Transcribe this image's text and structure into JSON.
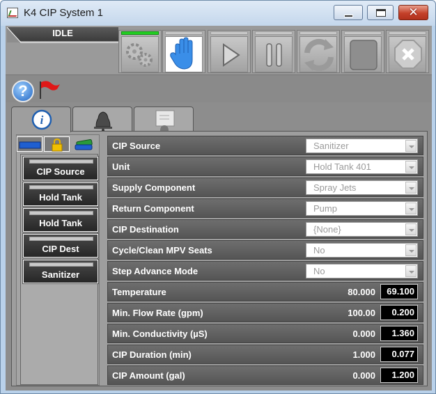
{
  "window": {
    "title": "K4 CIP System 1"
  },
  "toolbar": {
    "status": "IDLE",
    "buttons": [
      {
        "name": "auto",
        "icon": "gears-icon"
      },
      {
        "name": "manual",
        "icon": "hand-icon"
      },
      {
        "name": "start",
        "icon": "play-icon"
      },
      {
        "name": "pause",
        "icon": "pause-icon"
      },
      {
        "name": "restart",
        "icon": "refresh-icon"
      },
      {
        "name": "stop",
        "icon": "stop-icon"
      },
      {
        "name": "abort",
        "icon": "abort-icon"
      }
    ]
  },
  "tabs": [
    {
      "name": "info",
      "icon": "info-icon"
    },
    {
      "name": "alarms",
      "icon": "bell-icon"
    },
    {
      "name": "trend",
      "icon": "recipe-icon"
    }
  ],
  "left_list": [
    "CIP Source",
    "Hold Tank",
    "Hold Tank",
    "CIP Dest",
    "Sanitizer"
  ],
  "params": [
    {
      "label": "CIP Source",
      "value": "Sanitizer"
    },
    {
      "label": "Unit",
      "value": "Hold Tank 401"
    },
    {
      "label": "Supply Component",
      "value": "Spray Jets"
    },
    {
      "label": "Return Component",
      "value": "Pump"
    },
    {
      "label": "CIP Destination",
      "value": "{None}"
    },
    {
      "label": "Cycle/Clean MPV Seats",
      "value": "No"
    },
    {
      "label": "Step Advance Mode",
      "value": "No"
    }
  ],
  "measures": [
    {
      "label": "Temperature",
      "setpoint": "80.000",
      "actual": "69.100"
    },
    {
      "label": "Min. Flow Rate (gpm)",
      "setpoint": "100.00",
      "actual": "0.200"
    },
    {
      "label": "Min. Conductivity (µS)",
      "setpoint": "0.000",
      "actual": "1.360"
    },
    {
      "label": "CIP Duration (min)",
      "setpoint": "1.000",
      "actual": "0.077"
    },
    {
      "label": "CIP Amount (gal)",
      "setpoint": "0.000",
      "actual": "1.200"
    }
  ]
}
